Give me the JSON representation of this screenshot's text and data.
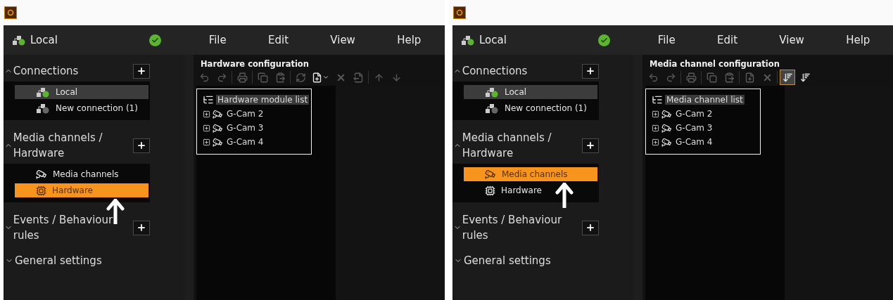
{
  "panels": [
    {
      "connection": {
        "name": "Local",
        "connected": true
      },
      "menu": [
        "File",
        "Edit",
        "View",
        "Help"
      ],
      "sidebar": [
        {
          "title": "Connections",
          "expanded": true,
          "add_button": true,
          "focused": false,
          "items": [
            {
              "label": "Local",
              "kind": "connection",
              "connected": true,
              "selected": true
            },
            {
              "label": "New connection (1)",
              "kind": "connection",
              "connected": false,
              "selected": false
            }
          ]
        },
        {
          "title": "Media channels / Hardware",
          "expanded": true,
          "add_button": true,
          "focused": true,
          "items": [
            {
              "label": "Media channels",
              "kind": "media",
              "selected": false
            },
            {
              "label": "Hardware",
              "kind": "hardware",
              "selected": true
            }
          ]
        },
        {
          "title": "Events / Behaviour rules",
          "expanded": false,
          "add_button": true
        },
        {
          "title": "General settings",
          "expanded": false
        }
      ],
      "content": {
        "title": "Hardware configuration",
        "toolbar": [
          {
            "kind": "undo",
            "disabled": true,
            "selected": false
          },
          {
            "kind": "redo",
            "disabled": true,
            "selected": false
          },
          {
            "kind": "separator"
          },
          {
            "kind": "print",
            "disabled": true,
            "selected": false
          },
          {
            "kind": "separator"
          },
          {
            "kind": "copy",
            "disabled": true,
            "selected": false
          },
          {
            "kind": "paste",
            "disabled": true,
            "selected": false
          },
          {
            "kind": "separator"
          },
          {
            "kind": "refresh",
            "disabled": true,
            "selected": false
          },
          {
            "kind": "add-menu",
            "disabled": false,
            "selected": false
          },
          {
            "kind": "delete",
            "disabled": true,
            "selected": false
          },
          {
            "kind": "export",
            "disabled": true,
            "selected": false
          },
          {
            "kind": "separator"
          },
          {
            "kind": "up",
            "disabled": true,
            "selected": false
          },
          {
            "kind": "down",
            "disabled": true,
            "selected": false
          }
        ],
        "tree": {
          "label": "Hardware module list",
          "selected": true,
          "children": [
            {
              "label": "G-Cam 2",
              "expanded": false
            },
            {
              "label": "G-Cam 3",
              "expanded": false
            },
            {
              "label": "G-Cam 4",
              "expanded": false
            }
          ]
        }
      }
    },
    {
      "connection": {
        "name": "Local",
        "connected": true
      },
      "menu": [
        "File",
        "Edit",
        "View",
        "Help"
      ],
      "sidebar": [
        {
          "title": "Connections",
          "expanded": true,
          "add_button": true,
          "focused": false,
          "items": [
            {
              "label": "Local",
              "kind": "connection",
              "connected": true,
              "selected": true
            },
            {
              "label": "New connection (1)",
              "kind": "connection",
              "connected": false,
              "selected": false
            }
          ]
        },
        {
          "title": "Media channels / Hardware",
          "expanded": true,
          "add_button": true,
          "focused": true,
          "items": [
            {
              "label": "Media channels",
              "kind": "media",
              "selected": true
            },
            {
              "label": "Hardware",
              "kind": "hardware",
              "selected": false
            }
          ]
        },
        {
          "title": "Events / Behaviour rules",
          "expanded": false,
          "add_button": true
        },
        {
          "title": "General settings",
          "expanded": false
        }
      ],
      "content": {
        "title": "Media channel configuration",
        "toolbar": [
          {
            "kind": "undo",
            "disabled": true,
            "selected": false
          },
          {
            "kind": "redo",
            "disabled": true,
            "selected": false
          },
          {
            "kind": "separator"
          },
          {
            "kind": "print",
            "disabled": true,
            "selected": false
          },
          {
            "kind": "separator"
          },
          {
            "kind": "copy",
            "disabled": true,
            "selected": false
          },
          {
            "kind": "paste",
            "disabled": true,
            "selected": false
          },
          {
            "kind": "separator"
          },
          {
            "kind": "add",
            "disabled": true,
            "selected": false
          },
          {
            "kind": "delete",
            "disabled": true,
            "selected": false
          },
          {
            "kind": "separator"
          },
          {
            "kind": "sort",
            "disabled": false,
            "selected": true
          },
          {
            "kind": "sort",
            "disabled": false,
            "selected": false
          }
        ],
        "tree": {
          "label": "Media channel list",
          "selected": true,
          "children": [
            {
              "label": "G-Cam 2",
              "expanded": false
            },
            {
              "label": "G-Cam 3",
              "expanded": false
            },
            {
              "label": "G-Cam 4",
              "expanded": false
            }
          ]
        }
      }
    }
  ]
}
